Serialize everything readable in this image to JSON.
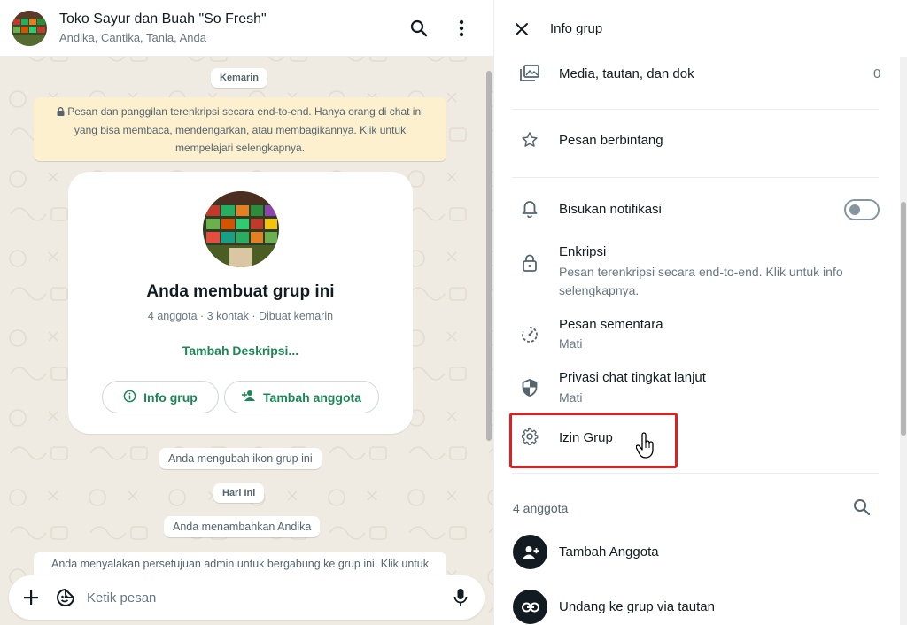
{
  "chat": {
    "header": {
      "title": "Toko Sayur dan Buah \"So Fresh\"",
      "members": "Andika, Cantika, Tania, Anda",
      "search_icon": "search-icon",
      "menu_icon": "more-vertical-icon"
    },
    "date_chip_yesterday": "Kemarin",
    "encryption_notice": "Pesan dan panggilan terenkripsi secara end-to-end. Hanya orang di chat ini yang bisa membaca, mendengarkan, atau membagikannya. Klik untuk mempelajari selengkapnya.",
    "created_card": {
      "title": "Anda membuat grup ini",
      "meta": "4 anggota · 3 kontak · Dibuat kemarin",
      "add_description": "Tambah Deskripsi...",
      "info_button": "Info grup",
      "add_member_button": "Tambah anggota"
    },
    "system_changed_icon": "Anda mengubah ikon grup ini",
    "date_chip_today": "Hari Ini",
    "system_added": "Anda menambahkan Andika",
    "system_admin_approval": "Anda menyalakan persetujuan admin untuk bergabung ke grup ini. Klik untuk",
    "composer": {
      "placeholder": "Ketik pesan"
    }
  },
  "info": {
    "title": "Info grup",
    "rows": {
      "media": {
        "label": "Media, tautan, dan dok",
        "count": "0"
      },
      "starred": {
        "label": "Pesan berbintang"
      },
      "mute": {
        "label": "Bisukan notifikasi",
        "enabled": false
      },
      "encryption": {
        "label": "Enkripsi",
        "sub": "Pesan terenkripsi secara end-to-end. Klik untuk info selengkapnya."
      },
      "disappearing": {
        "label": "Pesan sementara",
        "sub": "Mati"
      },
      "privacy": {
        "label": "Privasi chat tingkat lanjut",
        "sub": "Mati"
      },
      "permissions": {
        "label": "Izin Grup"
      }
    },
    "members_header": "4 anggota",
    "add_member": "Tambah Anggota",
    "invite_link": "Undang ke grup via tautan"
  },
  "colors": {
    "accent_green": "#1b8755",
    "highlight_red": "#e02020",
    "chat_bg": "#efeae2",
    "notice_yellow": "#fcf0cf"
  }
}
